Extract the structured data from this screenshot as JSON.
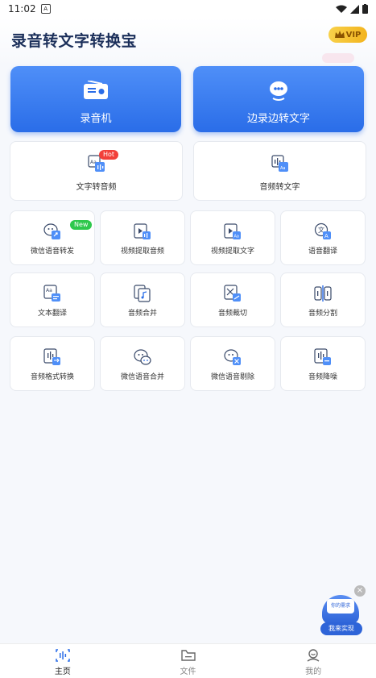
{
  "status_bar": {
    "time": "11:02",
    "left_icon": "A"
  },
  "header": {
    "title": "录音转文字转换宝",
    "vip_label": "VIP"
  },
  "big_cards": [
    {
      "label": "录音机",
      "icon": "radio-icon"
    },
    {
      "label": "边录边转文字",
      "icon": "mic-icon"
    }
  ],
  "mid_cards": [
    {
      "label": "文字转音频",
      "icon": "text-audio-icon",
      "badge": "Hot"
    },
    {
      "label": "音频转文字",
      "icon": "audio-text-icon"
    }
  ],
  "tiles": [
    {
      "label": "微信语音转发",
      "icon": "wechat-forward-icon",
      "badge": "New"
    },
    {
      "label": "视频提取音频",
      "icon": "video-audio-icon"
    },
    {
      "label": "视频提取文字",
      "icon": "video-text-icon"
    },
    {
      "label": "语音翻译",
      "icon": "voice-translate-icon"
    },
    {
      "label": "文本翻译",
      "icon": "text-translate-icon"
    },
    {
      "label": "音频合并",
      "icon": "audio-merge-icon"
    },
    {
      "label": "音频裁切",
      "icon": "audio-cut-icon"
    },
    {
      "label": "音频分割",
      "icon": "audio-split-icon"
    },
    {
      "label": "音频格式转换",
      "icon": "audio-format-icon"
    },
    {
      "label": "微信语音合并",
      "icon": "wechat-merge-icon"
    },
    {
      "label": "微信语音剔除",
      "icon": "wechat-remove-icon"
    },
    {
      "label": "音频降噪",
      "icon": "audio-denoise-icon"
    }
  ],
  "tabs": [
    {
      "label": "主页",
      "icon": "home-icon",
      "active": true
    },
    {
      "label": "文件",
      "icon": "folder-icon"
    },
    {
      "label": "我的",
      "icon": "profile-icon"
    }
  ],
  "float_ad": {
    "bubble": "你的需求",
    "button": "我来实现"
  },
  "colors": {
    "primary": "#2a6de8",
    "title": "#1b2f5a",
    "hot": "#f2403a",
    "new": "#2ec84c",
    "vip": "#f3b41e"
  }
}
